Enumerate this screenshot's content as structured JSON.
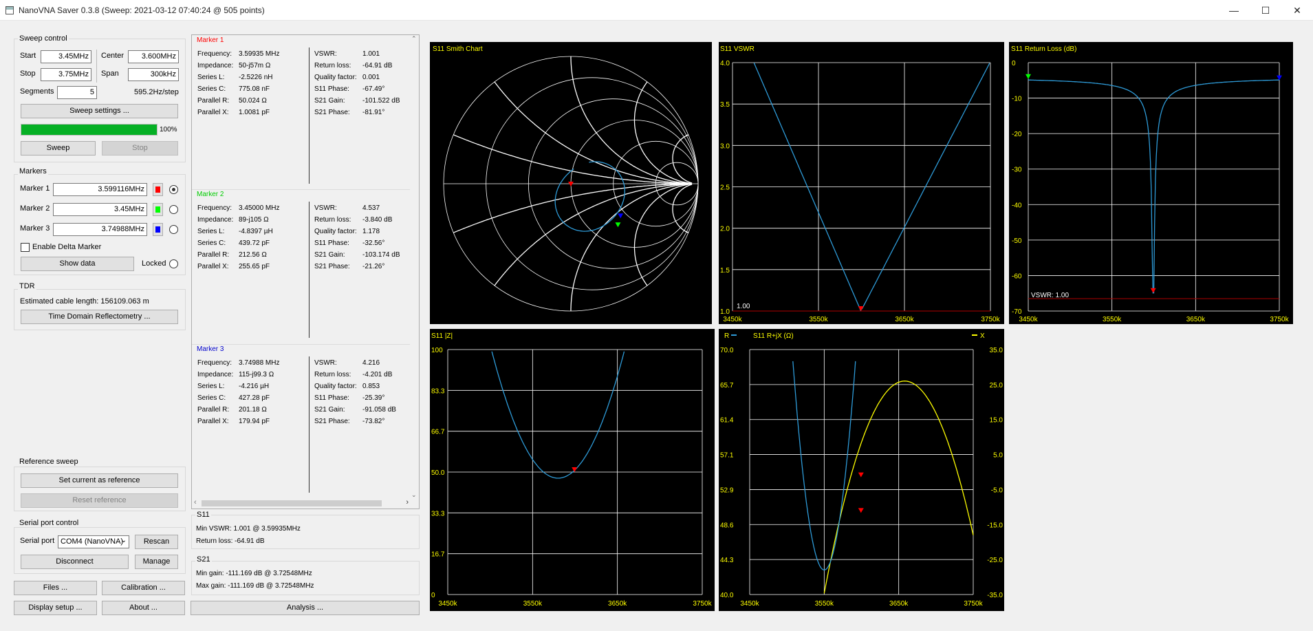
{
  "window": {
    "title": "NanoVNA Saver 0.3.8 (Sweep: 2021-03-12 07:40:24 @ 505 points)",
    "minimize": "—",
    "maximize": "☐",
    "close": "✕"
  },
  "sweep": {
    "group_title": "Sweep control",
    "start_label": "Start",
    "start_value": "3.45MHz",
    "center_label": "Center",
    "center_value": "3.600MHz",
    "stop_label": "Stop",
    "stop_value": "3.75MHz",
    "span_label": "Span",
    "span_value": "300kHz",
    "segments_label": "Segments",
    "segments_value": "5",
    "step_text": "595.2Hz/step",
    "settings_button": "Sweep settings ...",
    "progress_percent": 100,
    "progress_text": "100%",
    "sweep_button": "Sweep",
    "stop_button": "Stop"
  },
  "markers": {
    "group_title": "Markers",
    "items": [
      {
        "label": "Marker 1",
        "value": "3.599116MHz",
        "color": "#ff0000",
        "selected": true
      },
      {
        "label": "Marker 2",
        "value": "3.45MHz",
        "color": "#00ff00",
        "selected": false
      },
      {
        "label": "Marker 3",
        "value": "3.74988MHz",
        "color": "#0000ff",
        "selected": false
      }
    ],
    "delta_label": "Enable Delta Marker",
    "show_data_button": "Show data",
    "locked_label": "Locked"
  },
  "tdr": {
    "group_title": "TDR",
    "cable_text": "Estimated cable length: 156109.063 m",
    "tdr_button": "Time Domain Reflectometry ..."
  },
  "reference": {
    "group_title": "Reference sweep",
    "set_button": "Set current as reference",
    "reset_button": "Reset reference"
  },
  "serial": {
    "group_title": "Serial port control",
    "port_label": "Serial port",
    "port_value": "COM4 (NanoVNA)",
    "rescan_button": "Rescan",
    "disconnect_button": "Disconnect",
    "manage_button": "Manage"
  },
  "bottom_buttons": {
    "files": "Files ...",
    "calibration": "Calibration ...",
    "display": "Display setup ...",
    "about": "About ...",
    "analysis": "Analysis ..."
  },
  "marker_data": [
    {
      "title": "Marker 1",
      "color": "#ff0000",
      "left": [
        [
          "Frequency:",
          "3.59935 MHz"
        ],
        [
          "Impedance:",
          "50-j57m Ω"
        ],
        [
          "Series L:",
          "-2.5226 nH"
        ],
        [
          "Series C:",
          "775.08 nF"
        ],
        [
          "Parallel R:",
          "50.024 Ω"
        ],
        [
          "Parallel X:",
          "1.0081 pF"
        ]
      ],
      "right": [
        [
          "VSWR:",
          "1.001"
        ],
        [
          "Return loss:",
          "-64.91 dB"
        ],
        [
          "Quality factor:",
          "0.001"
        ],
        [
          "S11 Phase:",
          "-67.49°"
        ],
        [
          "S21 Gain:",
          "-101.522 dB"
        ],
        [
          "S21 Phase:",
          "-81.91°"
        ]
      ]
    },
    {
      "title": "Marker 2",
      "color": "#00cc00",
      "left": [
        [
          "Frequency:",
          "3.45000 MHz"
        ],
        [
          "Impedance:",
          "89-j105 Ω"
        ],
        [
          "Series L:",
          "-4.8397 µH"
        ],
        [
          "Series C:",
          "439.72 pF"
        ],
        [
          "Parallel R:",
          "212.56 Ω"
        ],
        [
          "Parallel X:",
          "255.65 pF"
        ]
      ],
      "right": [
        [
          "VSWR:",
          "4.537"
        ],
        [
          "Return loss:",
          "-3.840 dB"
        ],
        [
          "Quality factor:",
          "1.178"
        ],
        [
          "S11 Phase:",
          "-32.56°"
        ],
        [
          "S21 Gain:",
          "-103.174 dB"
        ],
        [
          "S21 Phase:",
          "-21.26°"
        ]
      ]
    },
    {
      "title": "Marker 3",
      "color": "#0000cc",
      "left": [
        [
          "Frequency:",
          "3.74988 MHz"
        ],
        [
          "Impedance:",
          "115-j99.3 Ω"
        ],
        [
          "Series L:",
          "-4.216 µH"
        ],
        [
          "Series C:",
          "427.28 pF"
        ],
        [
          "Parallel R:",
          "201.18 Ω"
        ],
        [
          "Parallel X:",
          "179.94 pF"
        ]
      ],
      "right": [
        [
          "VSWR:",
          "4.216"
        ],
        [
          "Return loss:",
          "-4.201 dB"
        ],
        [
          "Quality factor:",
          "0.853"
        ],
        [
          "S11 Phase:",
          "-25.39°"
        ],
        [
          "S21 Gain:",
          "-91.058 dB"
        ],
        [
          "S21 Phase:",
          "-73.82°"
        ]
      ]
    }
  ],
  "summary": {
    "s11_title": "S11",
    "min_vswr": "Min VSWR:   1.001 @ 3.59935MHz",
    "return_loss": "Return loss:   -64.91 dB",
    "s21_title": "S21",
    "min_gain": "Min gain:   -111.169 dB @ 3.72548MHz",
    "max_gain": "Max gain:   -111.169 dB @ 3.72548MHz"
  },
  "charts": {
    "smith": {
      "title": "S11 Smith Chart"
    },
    "vswr": {
      "title": "S11 VSWR",
      "y_ticks": [
        "4.0",
        "3.5",
        "3.0",
        "2.5",
        "2.0",
        "1.5",
        "1.0"
      ],
      "x_ticks": [
        "3450k",
        "3550k",
        "3650k",
        "3750k"
      ],
      "ref_label": "1.00"
    },
    "return_loss": {
      "title": "S11 Return Loss (dB)",
      "y_ticks": [
        "0",
        "-10",
        "-20",
        "-30",
        "-40",
        "-50",
        "-60",
        "-70"
      ],
      "x_ticks": [
        "3450k",
        "3550k",
        "3650k",
        "3750k"
      ],
      "ref_label": "VSWR: 1.00"
    },
    "impedance": {
      "title": "S11 |Z|",
      "y_ticks": [
        "100",
        "83.3",
        "66.7",
        "50.0",
        "33.3",
        "16.7",
        "0"
      ],
      "x_ticks": [
        "3450k",
        "3550k",
        "3650k",
        "3750k"
      ]
    },
    "rx": {
      "title": "S11 R+jX (Ω)",
      "r_legend": "R",
      "x_legend": "X",
      "y_ticks_left": [
        "70.0",
        "65.7",
        "61.4",
        "57.1",
        "52.9",
        "48.6",
        "44.3",
        "40.0"
      ],
      "y_ticks_right": [
        "35.0",
        "25.0",
        "15.0",
        "5.0",
        "-5.0",
        "-15.0",
        "-25.0",
        "-35.0"
      ],
      "x_ticks": [
        "3450k",
        "3550k",
        "3650k",
        "3750k"
      ]
    }
  },
  "colors": {
    "trace": "#2e9bd8",
    "trace_x": "#ffff00",
    "grid": "#ffffff",
    "progress": "#06b025",
    "marker_red": "#ff0000",
    "marker_green": "#00ff00",
    "marker_blue": "#0000ff"
  }
}
